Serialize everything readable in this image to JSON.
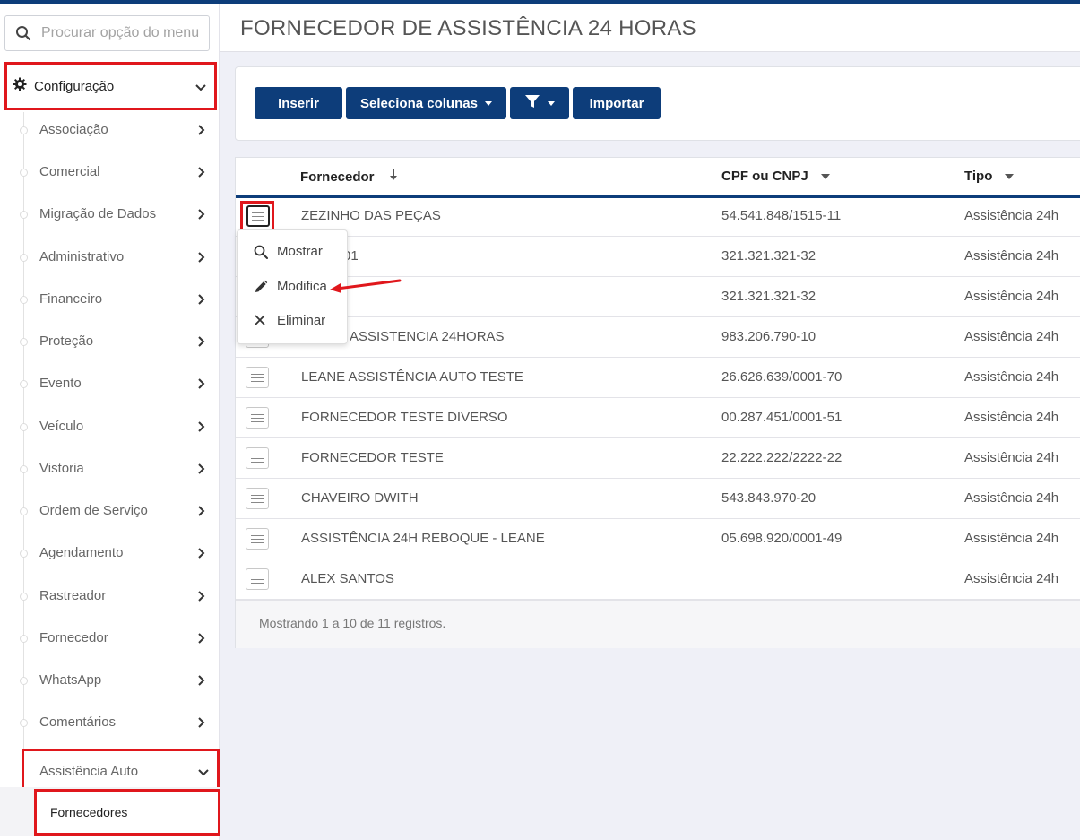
{
  "sidebar": {
    "search_placeholder": "Procurar opção do menu",
    "config_label": "Configuração",
    "items": [
      {
        "label": "Associação"
      },
      {
        "label": "Comercial"
      },
      {
        "label": "Migração de Dados"
      },
      {
        "label": "Administrativo"
      },
      {
        "label": "Financeiro"
      },
      {
        "label": "Proteção"
      },
      {
        "label": "Evento"
      },
      {
        "label": "Veículo"
      },
      {
        "label": "Vistoria"
      },
      {
        "label": "Ordem de Serviço"
      },
      {
        "label": "Agendamento"
      },
      {
        "label": "Rastreador"
      },
      {
        "label": "Fornecedor"
      },
      {
        "label": "WhatsApp"
      },
      {
        "label": "Comentários"
      }
    ],
    "assist_label": "Assistência Auto",
    "submenu_label": "Fornecedores"
  },
  "header": {
    "title": "FORNECEDOR DE ASSISTÊNCIA 24 HORAS"
  },
  "toolbar": {
    "insert_label": "Inserir",
    "columns_label": "Seleciona colunas",
    "import_label": "Importar"
  },
  "table": {
    "columns": [
      "Fornecedor",
      "CPF ou CNPJ",
      "Tipo"
    ],
    "rows": [
      {
        "fornecedor": "ZEZINHO DAS PEÇAS",
        "doc": "54.541.848/1515-11",
        "tipo": "Assistência 24h"
      },
      {
        "fornecedor": "01",
        "doc": "321.321.321-32",
        "tipo": "Assistência 24h"
      },
      {
        "fornecedor": "",
        "doc": "321.321.321-32",
        "tipo": "Assistência 24h"
      },
      {
        "fornecedor": "ASSISTENCIA 24HORAS",
        "doc": "983.206.790-10",
        "tipo": "Assistência 24h"
      },
      {
        "fornecedor": "LEANE ASSISTÊNCIA AUTO TESTE",
        "doc": "26.626.639/0001-70",
        "tipo": "Assistência 24h"
      },
      {
        "fornecedor": "FORNECEDOR TESTE DIVERSO",
        "doc": "00.287.451/0001-51",
        "tipo": "Assistência 24h"
      },
      {
        "fornecedor": "FORNECEDOR TESTE",
        "doc": "22.222.222/2222-22",
        "tipo": "Assistência 24h"
      },
      {
        "fornecedor": "CHAVEIRO DWITH",
        "doc": "543.843.970-20",
        "tipo": "Assistência 24h"
      },
      {
        "fornecedor": "ASSISTÊNCIA 24H REBOQUE - LEANE",
        "doc": "05.698.920/0001-49",
        "tipo": "Assistência 24h"
      },
      {
        "fornecedor": "ALEX SANTOS",
        "doc": "",
        "tipo": "Assistência 24h"
      }
    ],
    "footer": "Mostrando 1 a 10 de 11 registros."
  },
  "row_menu": {
    "show_label": "Mostrar",
    "edit_label": "Modifica",
    "delete_label": "Eliminar"
  },
  "colors": {
    "primary": "#0d3d7a",
    "highlight": "#e0171c"
  }
}
